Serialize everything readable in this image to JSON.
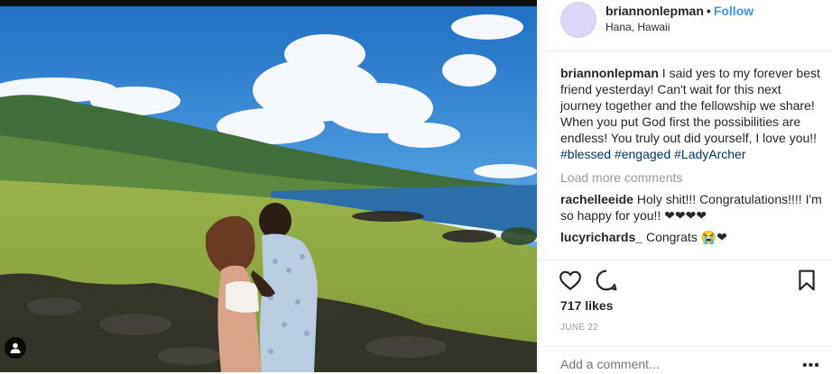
{
  "post": {
    "username": "briannonlepman",
    "dot": "•",
    "follow_label": "Follow",
    "location": "Hana, Hawaii"
  },
  "caption": {
    "username": "briannonlepman",
    "text": "I said yes to my forever best friend yesterday! Can't wait for this next journey together and the fellowship we share! When you put God first the possibilities are endless! You truly out did yourself, I love you!!",
    "tags": [
      "#blessed",
      "#engaged",
      "#LadyArcher"
    ]
  },
  "load_more": "Load more comments",
  "comments": [
    {
      "username": "rachelleeide",
      "text": "Holy shit!!! Congratulations!!!! I'm so happy for you!! ❤❤❤❤"
    },
    {
      "username": "lucyrichards_",
      "text": "Congrats 😭❤"
    }
  ],
  "actions": {
    "like_icon": "heart-icon",
    "comment_icon": "comment-icon",
    "save_icon": "bookmark-icon"
  },
  "likes": "717 likes",
  "date": "JUNE 22",
  "add_comment": {
    "placeholder": "Add a comment..."
  },
  "more_options": "•••",
  "colors": {
    "link": "#3897f0",
    "hashtag": "#003569",
    "muted": "#999999",
    "text": "#262626"
  }
}
